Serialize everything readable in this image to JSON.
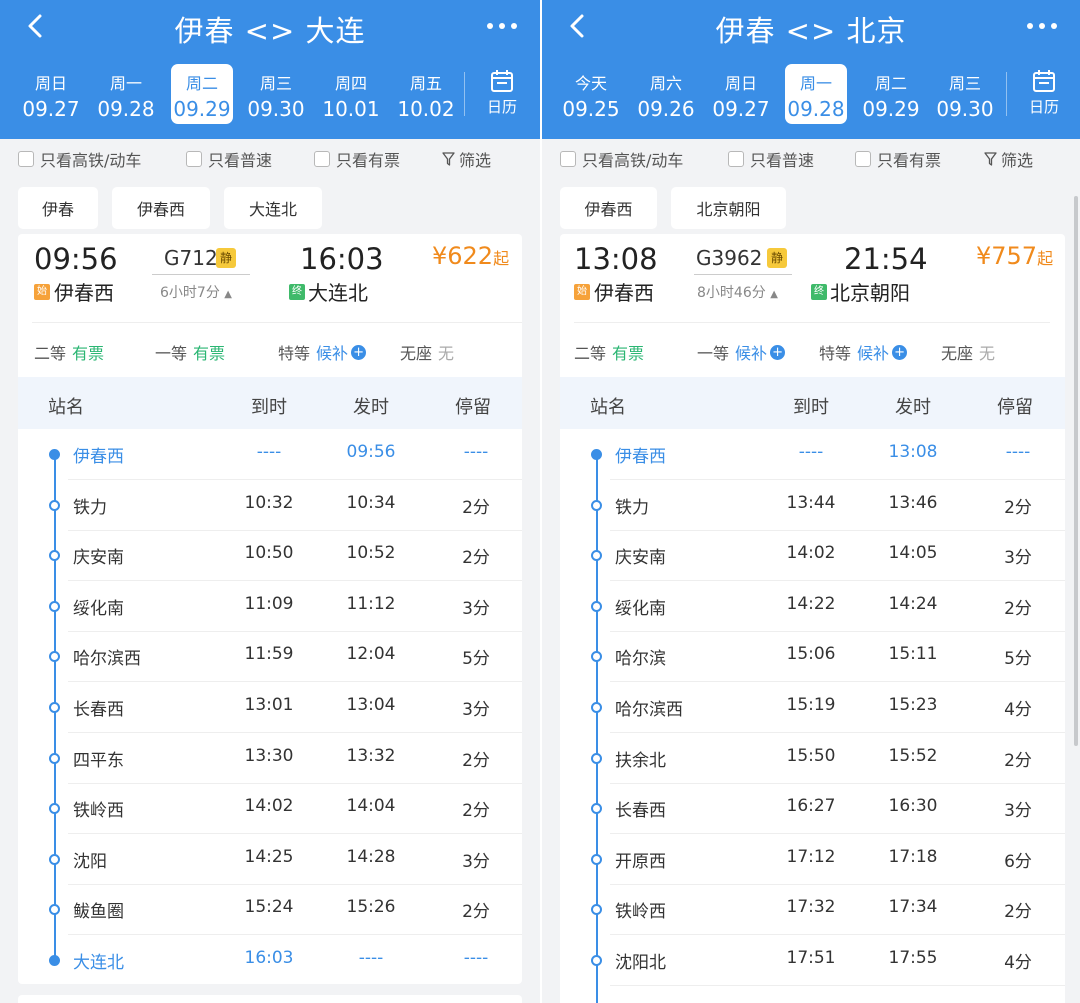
{
  "left": {
    "title": "伊春 <> 大连",
    "dates": [
      {
        "wd": "周日",
        "dd": "09.27",
        "selected": false
      },
      {
        "wd": "周一",
        "dd": "09.28",
        "selected": false
      },
      {
        "wd": "周二",
        "dd": "09.29",
        "selected": true
      },
      {
        "wd": "周三",
        "dd": "09.30",
        "selected": false
      },
      {
        "wd": "周四",
        "dd": "10.01",
        "selected": false
      },
      {
        "wd": "周五",
        "dd": "10.02",
        "selected": false
      }
    ],
    "calendar_label": "日历",
    "filters": [
      "只看高铁/动车",
      "只看普速",
      "只看有票",
      "筛选"
    ],
    "stations": [
      "伊春",
      "伊春西",
      "大连北"
    ],
    "train": {
      "dep_time": "09:56",
      "number": "G712",
      "quiet_badge": "静",
      "duration": "6小时7分",
      "arr_time": "16:03",
      "price": "¥622",
      "price_suffix": "起",
      "start_tag": "始",
      "end_tag": "终",
      "from": "伊春西",
      "to": "大连北",
      "seats": [
        {
          "class": "二等",
          "status": "有票",
          "color": "green",
          "plus": false
        },
        {
          "class": "一等",
          "status": "有票",
          "color": "green",
          "plus": false
        },
        {
          "class": "特等",
          "status": "候补",
          "color": "blue",
          "plus": true
        },
        {
          "class": "无座",
          "status": "无",
          "color": "gray",
          "plus": false
        }
      ]
    },
    "table_headers": [
      "站名",
      "到时",
      "发时",
      "停留"
    ],
    "stops": [
      {
        "name": "伊春西",
        "arr": "----",
        "dep": "09:56",
        "stay": "----",
        "hl": true
      },
      {
        "name": "铁力",
        "arr": "10:32",
        "dep": "10:34",
        "stay": "2分",
        "hl": false
      },
      {
        "name": "庆安南",
        "arr": "10:50",
        "dep": "10:52",
        "stay": "2分",
        "hl": false
      },
      {
        "name": "绥化南",
        "arr": "11:09",
        "dep": "11:12",
        "stay": "3分",
        "hl": false
      },
      {
        "name": "哈尔滨西",
        "arr": "11:59",
        "dep": "12:04",
        "stay": "5分",
        "hl": false
      },
      {
        "name": "长春西",
        "arr": "13:01",
        "dep": "13:04",
        "stay": "3分",
        "hl": false
      },
      {
        "name": "四平东",
        "arr": "13:30",
        "dep": "13:32",
        "stay": "2分",
        "hl": false
      },
      {
        "name": "铁岭西",
        "arr": "14:02",
        "dep": "14:04",
        "stay": "2分",
        "hl": false
      },
      {
        "name": "沈阳",
        "arr": "14:25",
        "dep": "14:28",
        "stay": "3分",
        "hl": false
      },
      {
        "name": "鲅鱼圈",
        "arr": "15:24",
        "dep": "15:26",
        "stay": "2分",
        "hl": false
      },
      {
        "name": "大连北",
        "arr": "16:03",
        "dep": "----",
        "stay": "----",
        "hl": true
      }
    ]
  },
  "right": {
    "title": "伊春 <> 北京",
    "dates": [
      {
        "wd": "今天",
        "dd": "09.25",
        "selected": false
      },
      {
        "wd": "周六",
        "dd": "09.26",
        "selected": false
      },
      {
        "wd": "周日",
        "dd": "09.27",
        "selected": false
      },
      {
        "wd": "周一",
        "dd": "09.28",
        "selected": true
      },
      {
        "wd": "周二",
        "dd": "09.29",
        "selected": false
      },
      {
        "wd": "周三",
        "dd": "09.30",
        "selected": false
      }
    ],
    "calendar_label": "日历",
    "filters": [
      "只看高铁/动车",
      "只看普速",
      "只看有票",
      "筛选"
    ],
    "stations": [
      "伊春西",
      "北京朝阳"
    ],
    "train": {
      "dep_time": "13:08",
      "number": "G3962",
      "quiet_badge": "静",
      "duration": "8小时46分",
      "arr_time": "21:54",
      "price": "¥757",
      "price_suffix": "起",
      "start_tag": "始",
      "end_tag": "终",
      "from": "伊春西",
      "to": "北京朝阳",
      "seats": [
        {
          "class": "二等",
          "status": "有票",
          "color": "green",
          "plus": false
        },
        {
          "class": "一等",
          "status": "候补",
          "color": "blue",
          "plus": true
        },
        {
          "class": "特等",
          "status": "候补",
          "color": "blue",
          "plus": true
        },
        {
          "class": "无座",
          "status": "无",
          "color": "gray",
          "plus": false
        }
      ]
    },
    "table_headers": [
      "站名",
      "到时",
      "发时",
      "停留"
    ],
    "stops": [
      {
        "name": "伊春西",
        "arr": "----",
        "dep": "13:08",
        "stay": "----",
        "hl": true
      },
      {
        "name": "铁力",
        "arr": "13:44",
        "dep": "13:46",
        "stay": "2分",
        "hl": false
      },
      {
        "name": "庆安南",
        "arr": "14:02",
        "dep": "14:05",
        "stay": "3分",
        "hl": false
      },
      {
        "name": "绥化南",
        "arr": "14:22",
        "dep": "14:24",
        "stay": "2分",
        "hl": false
      },
      {
        "name": "哈尔滨",
        "arr": "15:06",
        "dep": "15:11",
        "stay": "5分",
        "hl": false
      },
      {
        "name": "哈尔滨西",
        "arr": "15:19",
        "dep": "15:23",
        "stay": "4分",
        "hl": false
      },
      {
        "name": "扶余北",
        "arr": "15:50",
        "dep": "15:52",
        "stay": "2分",
        "hl": false
      },
      {
        "name": "长春西",
        "arr": "16:27",
        "dep": "16:30",
        "stay": "3分",
        "hl": false
      },
      {
        "name": "开原西",
        "arr": "17:12",
        "dep": "17:18",
        "stay": "6分",
        "hl": false
      },
      {
        "name": "铁岭西",
        "arr": "17:32",
        "dep": "17:34",
        "stay": "2分",
        "hl": false
      },
      {
        "name": "沈阳北",
        "arr": "17:51",
        "dep": "17:55",
        "stay": "4分",
        "hl": false
      }
    ]
  },
  "colors": {
    "accent": "#3a8ee6",
    "price": "#f08a1c",
    "green": "#2bb673",
    "badge": "#f6c93b"
  }
}
